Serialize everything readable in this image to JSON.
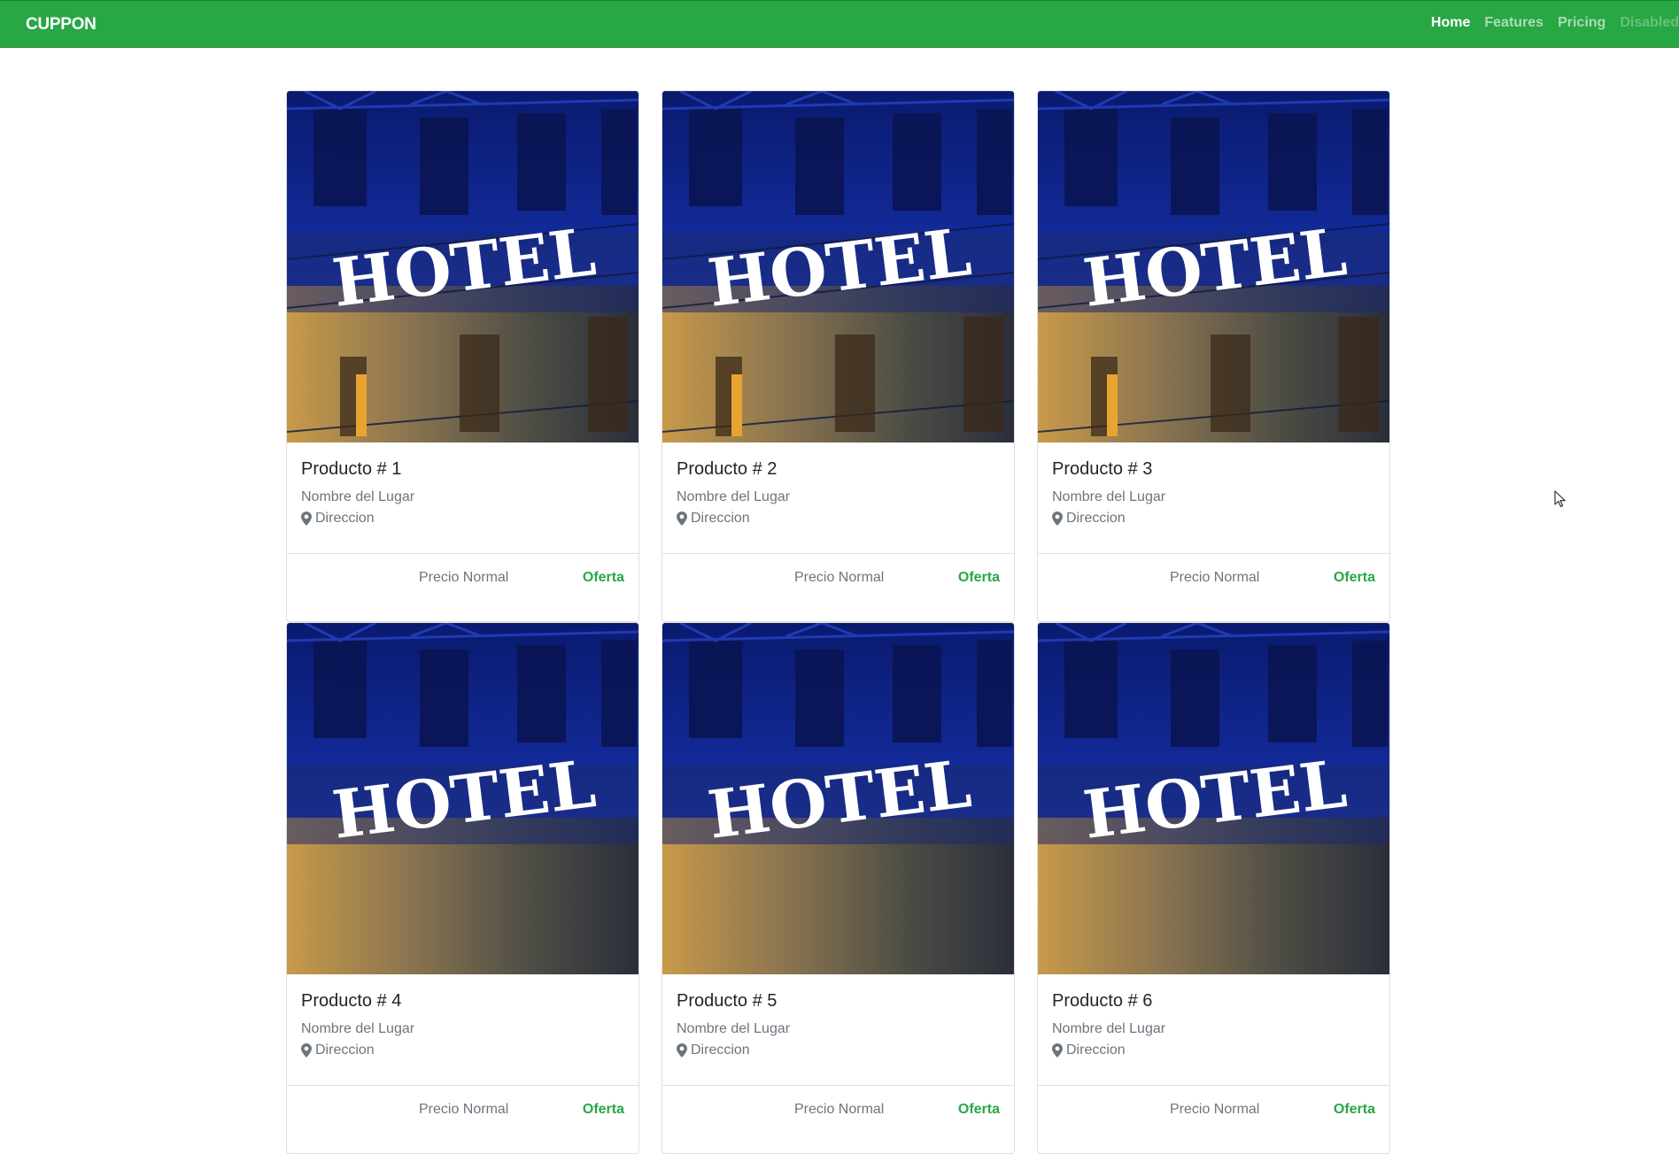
{
  "navbar": {
    "brand": "CUPPON",
    "links": [
      {
        "label": "Home",
        "state": "active"
      },
      {
        "label": "Features",
        "state": "normal"
      },
      {
        "label": "Pricing",
        "state": "normal"
      },
      {
        "label": "Disabled",
        "state": "disabled"
      }
    ]
  },
  "image_sign_text": "HOTEL",
  "cards": [
    {
      "title": "Producto # 1",
      "place": "Nombre del Lugar",
      "address": "Direccion",
      "price_normal": "Precio Normal",
      "price_offer": "Oferta"
    },
    {
      "title": "Producto # 2",
      "place": "Nombre del Lugar",
      "address": "Direccion",
      "price_normal": "Precio Normal",
      "price_offer": "Oferta"
    },
    {
      "title": "Producto # 3",
      "place": "Nombre del Lugar",
      "address": "Direccion",
      "price_normal": "Precio Normal",
      "price_offer": "Oferta"
    },
    {
      "title": "Producto # 4",
      "place": "Nombre del Lugar",
      "address": "Direccion",
      "price_normal": "Precio Normal",
      "price_offer": "Oferta"
    },
    {
      "title": "Producto # 5",
      "place": "Nombre del Lugar",
      "address": "Direccion",
      "price_normal": "Precio Normal",
      "price_offer": "Oferta"
    },
    {
      "title": "Producto # 6",
      "place": "Nombre del Lugar",
      "address": "Direccion",
      "price_normal": "Precio Normal",
      "price_offer": "Oferta"
    }
  ],
  "colors": {
    "navbar_bg": "#28a745",
    "offer_text": "#28a745",
    "muted_text": "#6c757d"
  },
  "icons": {
    "address": "map-marker-icon",
    "cursor": "mouse-pointer-icon"
  }
}
